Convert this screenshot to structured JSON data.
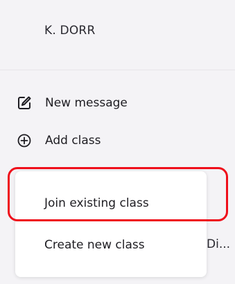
{
  "user": {
    "name": "K. DORR"
  },
  "actions": [
    {
      "label": "New message",
      "icon": "edit-square-icon"
    },
    {
      "label": "Add class",
      "icon": "plus-circle-icon"
    }
  ],
  "menu": {
    "items": [
      {
        "label": "Join existing class"
      },
      {
        "label": "Create new class"
      }
    ]
  },
  "background_text": "Di...",
  "colors": {
    "page_background": "#f4f3f6",
    "menu_background": "#ffffff",
    "highlight_outline": "#ef0f1b",
    "text": "#1e1d22"
  }
}
